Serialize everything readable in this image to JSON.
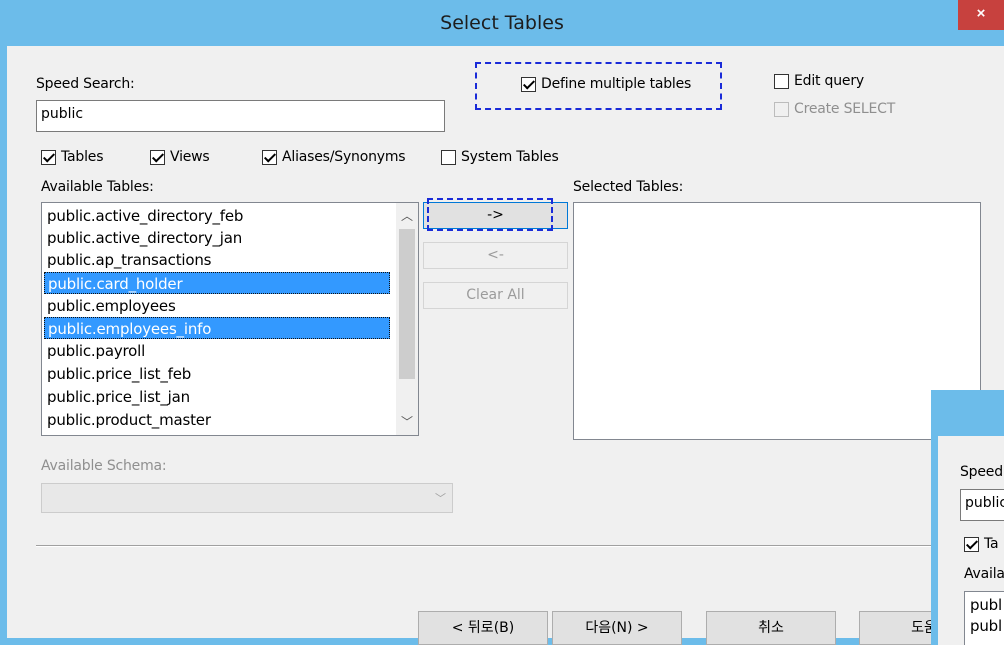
{
  "window": {
    "title": "Select Tables",
    "close_label": "×"
  },
  "speed_search": {
    "label": "Speed Search:",
    "value": "public"
  },
  "options": {
    "define_multiple": {
      "label": "Define multiple tables",
      "checked": true
    },
    "edit_query": {
      "label": "Edit query",
      "checked": false
    },
    "create_select": {
      "label": "Create SELECT",
      "checked": false,
      "disabled": true
    }
  },
  "filters": {
    "tables": {
      "label": "Tables",
      "checked": true
    },
    "views": {
      "label": "Views",
      "checked": true
    },
    "aliases": {
      "label": "Aliases/Synonyms",
      "checked": true
    },
    "system": {
      "label": "System Tables",
      "checked": false
    }
  },
  "available_tables": {
    "label": "Available Tables:",
    "items": [
      {
        "name": "public.active_directory_feb",
        "selected": false
      },
      {
        "name": "public.active_directory_jan",
        "selected": false
      },
      {
        "name": "public.ap_transactions",
        "selected": false
      },
      {
        "name": "public.card_holder",
        "selected": true
      },
      {
        "name": "public.employees",
        "selected": false
      },
      {
        "name": "public.employees_info",
        "selected": true
      },
      {
        "name": "public.payroll",
        "selected": false
      },
      {
        "name": "public.price_list_feb",
        "selected": false
      },
      {
        "name": "public.price_list_jan",
        "selected": false
      },
      {
        "name": "public.product_master",
        "selected": false
      }
    ]
  },
  "transfer": {
    "add_label": "->",
    "remove_label": "<-",
    "clear_label": "Clear All"
  },
  "selected_tables": {
    "label": "Selected Tables:",
    "items": []
  },
  "schema": {
    "label": "Available Schema:",
    "value": ""
  },
  "footer": {
    "back_label": "< 뒤로(B)",
    "next_label": "다음(N) >",
    "cancel_label": "취소",
    "help_label": "도움"
  },
  "overlay": {
    "speed_label": "Speed",
    "search_value": "public",
    "tables_label": "Ta",
    "available_label": "Availa",
    "items": [
      "publ",
      "publ"
    ]
  },
  "colors": {
    "title_bar": "#6cbcea",
    "close_button": "#c7413e",
    "selection": "#3399ff",
    "highlight_dash": "#1a2bd8"
  }
}
